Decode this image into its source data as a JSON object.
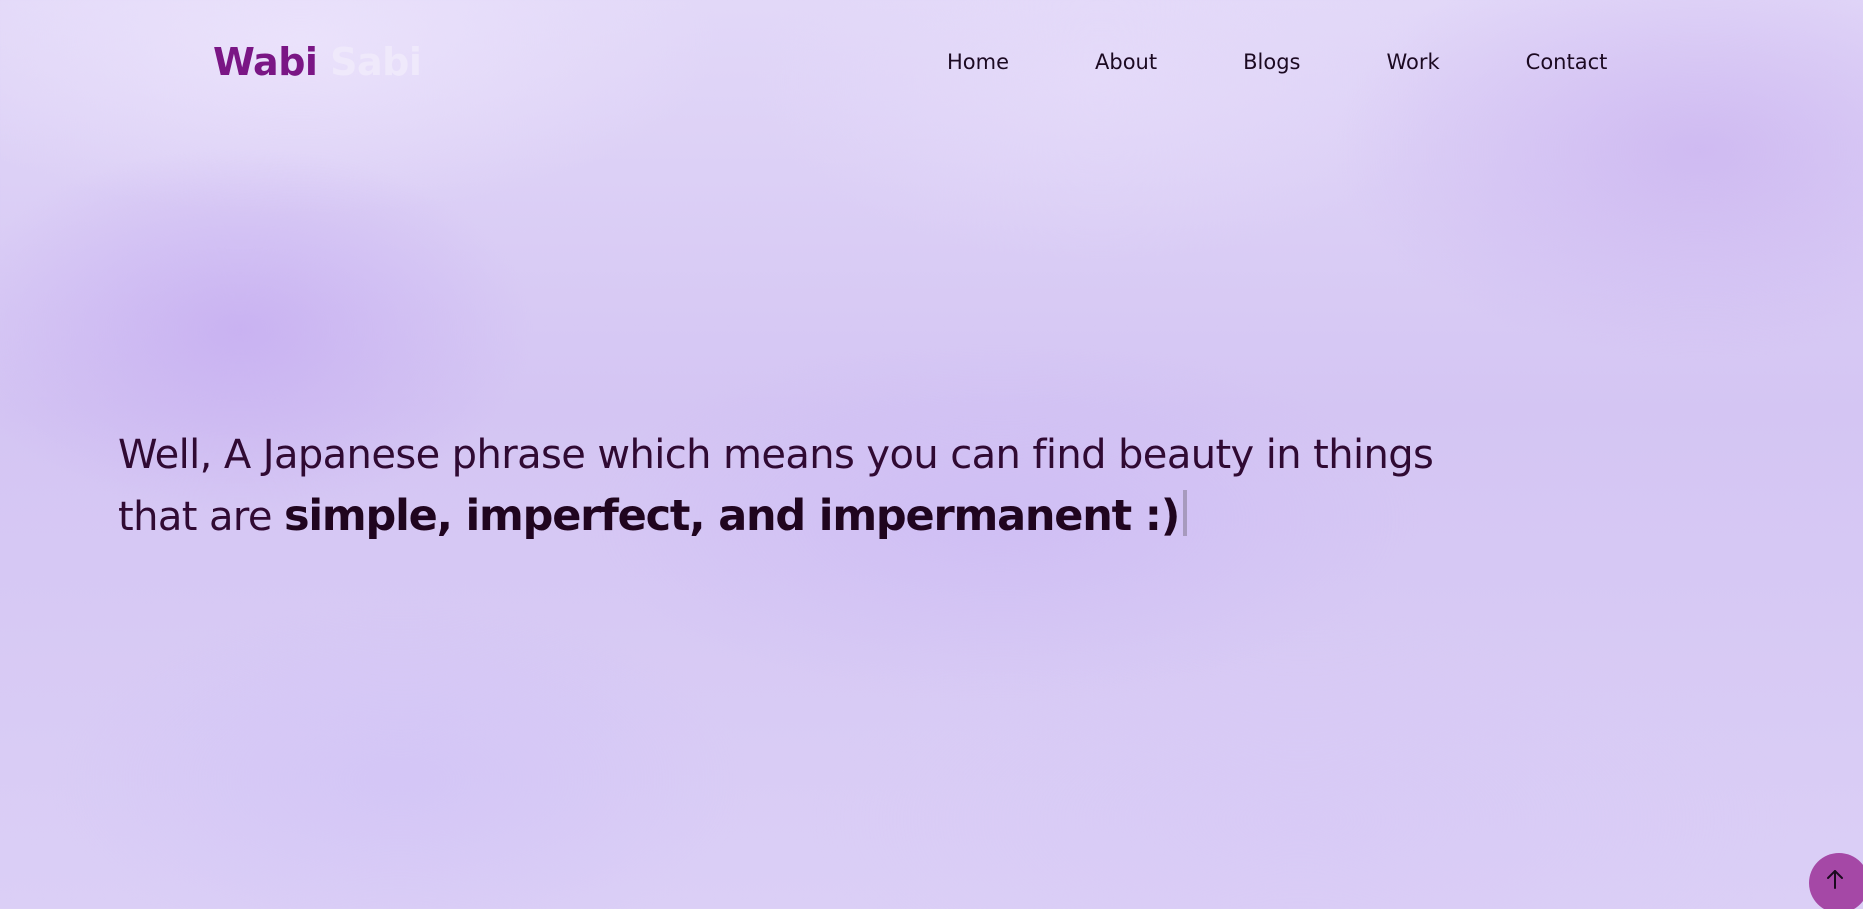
{
  "brand": {
    "first": "Wabi",
    "second": "Sabi",
    "colors": {
      "first": "#7a1685",
      "second": "#efe9fb"
    }
  },
  "nav": {
    "items": [
      {
        "label": "Home"
      },
      {
        "label": "About"
      },
      {
        "label": "Blogs"
      },
      {
        "label": "Work"
      },
      {
        "label": "Contact"
      }
    ]
  },
  "hero": {
    "line1": "Well, A Japanese phrase which means you can find beauty in things",
    "line2_prefix": "that are ",
    "line2_emphasis": "simple, imperfect, and impermanent :)"
  },
  "scroll_top": {
    "icon": "arrow-up-icon",
    "color": "#a548a6"
  },
  "theme": {
    "background": "#d9ccf5",
    "text": "#300a33"
  }
}
